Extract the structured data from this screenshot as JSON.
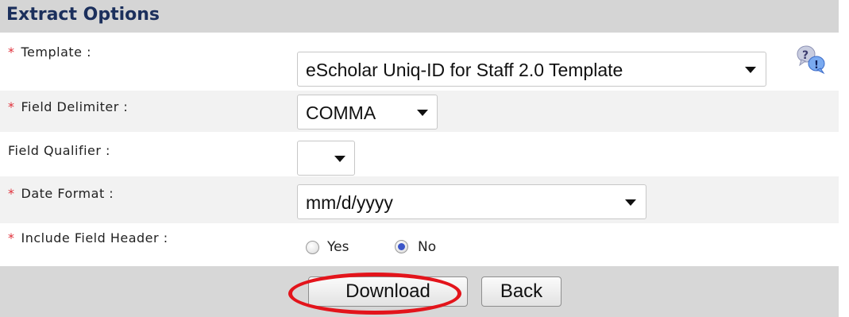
{
  "panel": {
    "title": "Extract Options"
  },
  "fields": {
    "required_marker": "*",
    "template": {
      "label": "Template :",
      "value": "eScholar Uniq-ID for Staff 2.0 Template"
    },
    "field_delimiter": {
      "label": "Field Delimiter :",
      "value": "COMMA"
    },
    "field_qualifier": {
      "label": "Field Qualifier :",
      "value": ""
    },
    "date_format": {
      "label": "Date Format :",
      "value": "mm/d/yyyy"
    },
    "include_header": {
      "label": "Include Field Header :",
      "options": [
        "Yes",
        "No"
      ],
      "selected": "No"
    }
  },
  "help": {
    "icon": "help-question-icon",
    "glyph_q": "?",
    "glyph_e": "!"
  },
  "actions": {
    "download_label": "Download",
    "back_label": "Back"
  },
  "annotation": {
    "color": "#e3141b",
    "target": "download-button"
  }
}
